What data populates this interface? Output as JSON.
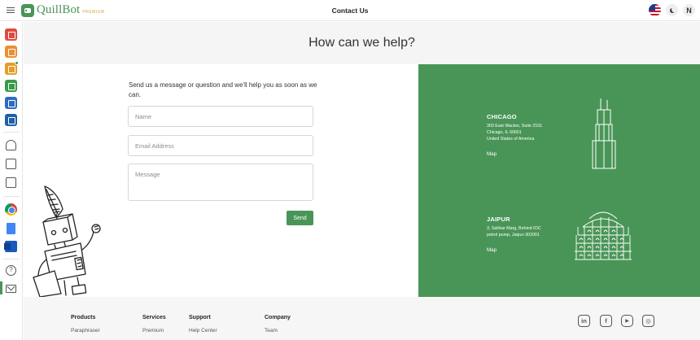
{
  "header": {
    "brand_name": "QuillBot",
    "brand_badge": "PREMIUM",
    "page_title": "Contact Us",
    "user_initial": "N",
    "menu_icon": "hamburger-icon",
    "theme_icon": "moon-icon",
    "language_icon": "us-flag-icon"
  },
  "sidebar": {
    "items": [
      {
        "name": "paraphraser",
        "icon": "paraphraser-icon",
        "color": "#e14a3f"
      },
      {
        "name": "grammar-checker",
        "icon": "grammar-checker-icon",
        "color": "#eb8f33"
      },
      {
        "name": "plagiarism-checker",
        "icon": "plagiarism-checker-icon",
        "color": "#e69c2b"
      },
      {
        "name": "co-writer",
        "icon": "co-writer-icon",
        "color": "#3b9a4b"
      },
      {
        "name": "summarizer",
        "icon": "summarizer-icon",
        "color": "#2d6bc2"
      },
      {
        "name": "citation-generator",
        "icon": "citation-generator-icon",
        "color": "#1e5fa8"
      },
      {
        "name": "translator",
        "icon": "translator-icon",
        "color": "#555555"
      },
      {
        "name": "notebook",
        "icon": "notebook-icon",
        "color": "#555555"
      },
      {
        "name": "workspace",
        "icon": "workspace-icon",
        "color": "#555555"
      },
      {
        "name": "chrome-extension",
        "icon": "chrome-icon",
        "color": "#4285f4"
      },
      {
        "name": "google-docs",
        "icon": "google-docs-icon",
        "color": "#4285f4"
      },
      {
        "name": "word-addin",
        "icon": "word-icon",
        "color": "#185abd"
      },
      {
        "name": "help",
        "icon": "help-icon",
        "color": "#555555"
      },
      {
        "name": "contact",
        "icon": "mail-icon",
        "color": "#555555"
      }
    ]
  },
  "hero": {
    "title": "How can we help?"
  },
  "form": {
    "intro": "Send us a message or question and we'll help you as soon as we can.",
    "name_placeholder": "Name",
    "email_placeholder": "Email Address",
    "message_placeholder": "Message",
    "name_value": "",
    "email_value": "",
    "message_value": "",
    "submit_label": "Send"
  },
  "offices": [
    {
      "city": "CHICAGO",
      "address_lines": [
        "303 East Wacker, Suite 2101",
        "Chicago, IL 60601",
        "United States of America"
      ],
      "map_label": "Map",
      "landmark_icon": "skyscraper-icon"
    },
    {
      "city": "JAIPUR",
      "address_lines": [
        "3, Sahkar Marg, Behind IOC",
        "petrol pump, Jaipur-302001"
      ],
      "map_label": "Map",
      "landmark_icon": "hawa-mahal-icon"
    }
  ],
  "footer": {
    "columns": [
      {
        "heading": "Products",
        "links": [
          "Paraphraser"
        ]
      },
      {
        "heading": "Services",
        "links": [
          "Premium"
        ]
      },
      {
        "heading": "Support",
        "links": [
          "Help Center"
        ]
      },
      {
        "heading": "Company",
        "links": [
          "Team"
        ]
      }
    ],
    "social": [
      {
        "name": "linkedin",
        "icon": "linkedin-icon",
        "glyph": "in"
      },
      {
        "name": "facebook",
        "icon": "facebook-icon",
        "glyph": "f"
      },
      {
        "name": "youtube",
        "icon": "youtube-icon",
        "glyph": "▶"
      },
      {
        "name": "instagram",
        "icon": "instagram-icon",
        "glyph": "◎"
      }
    ]
  },
  "colors": {
    "brand_green": "#499557",
    "hero_bg": "#f5f5f5",
    "footer_bg": "#f6f6f6",
    "premium_gold": "#d3a93b"
  }
}
